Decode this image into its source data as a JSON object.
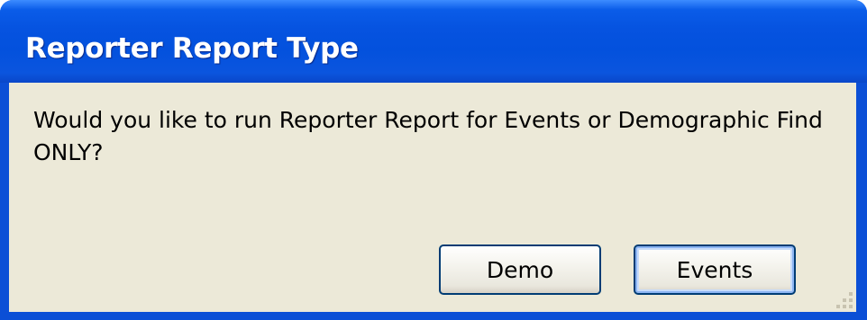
{
  "dialog": {
    "title": "Reporter Report Type",
    "message": "Would you like to run Reporter Report for Events or Demographic Find ONLY?",
    "buttons": {
      "demo_label": "Demo",
      "events_label": "Events"
    },
    "default_button": "Events"
  },
  "colors": {
    "titlebar": "#0351dd",
    "client_background": "#ece9d8",
    "button_border": "#003c74",
    "focus_ring": "#8cb4f2"
  },
  "icons": [
    "size-grip-icon"
  ]
}
